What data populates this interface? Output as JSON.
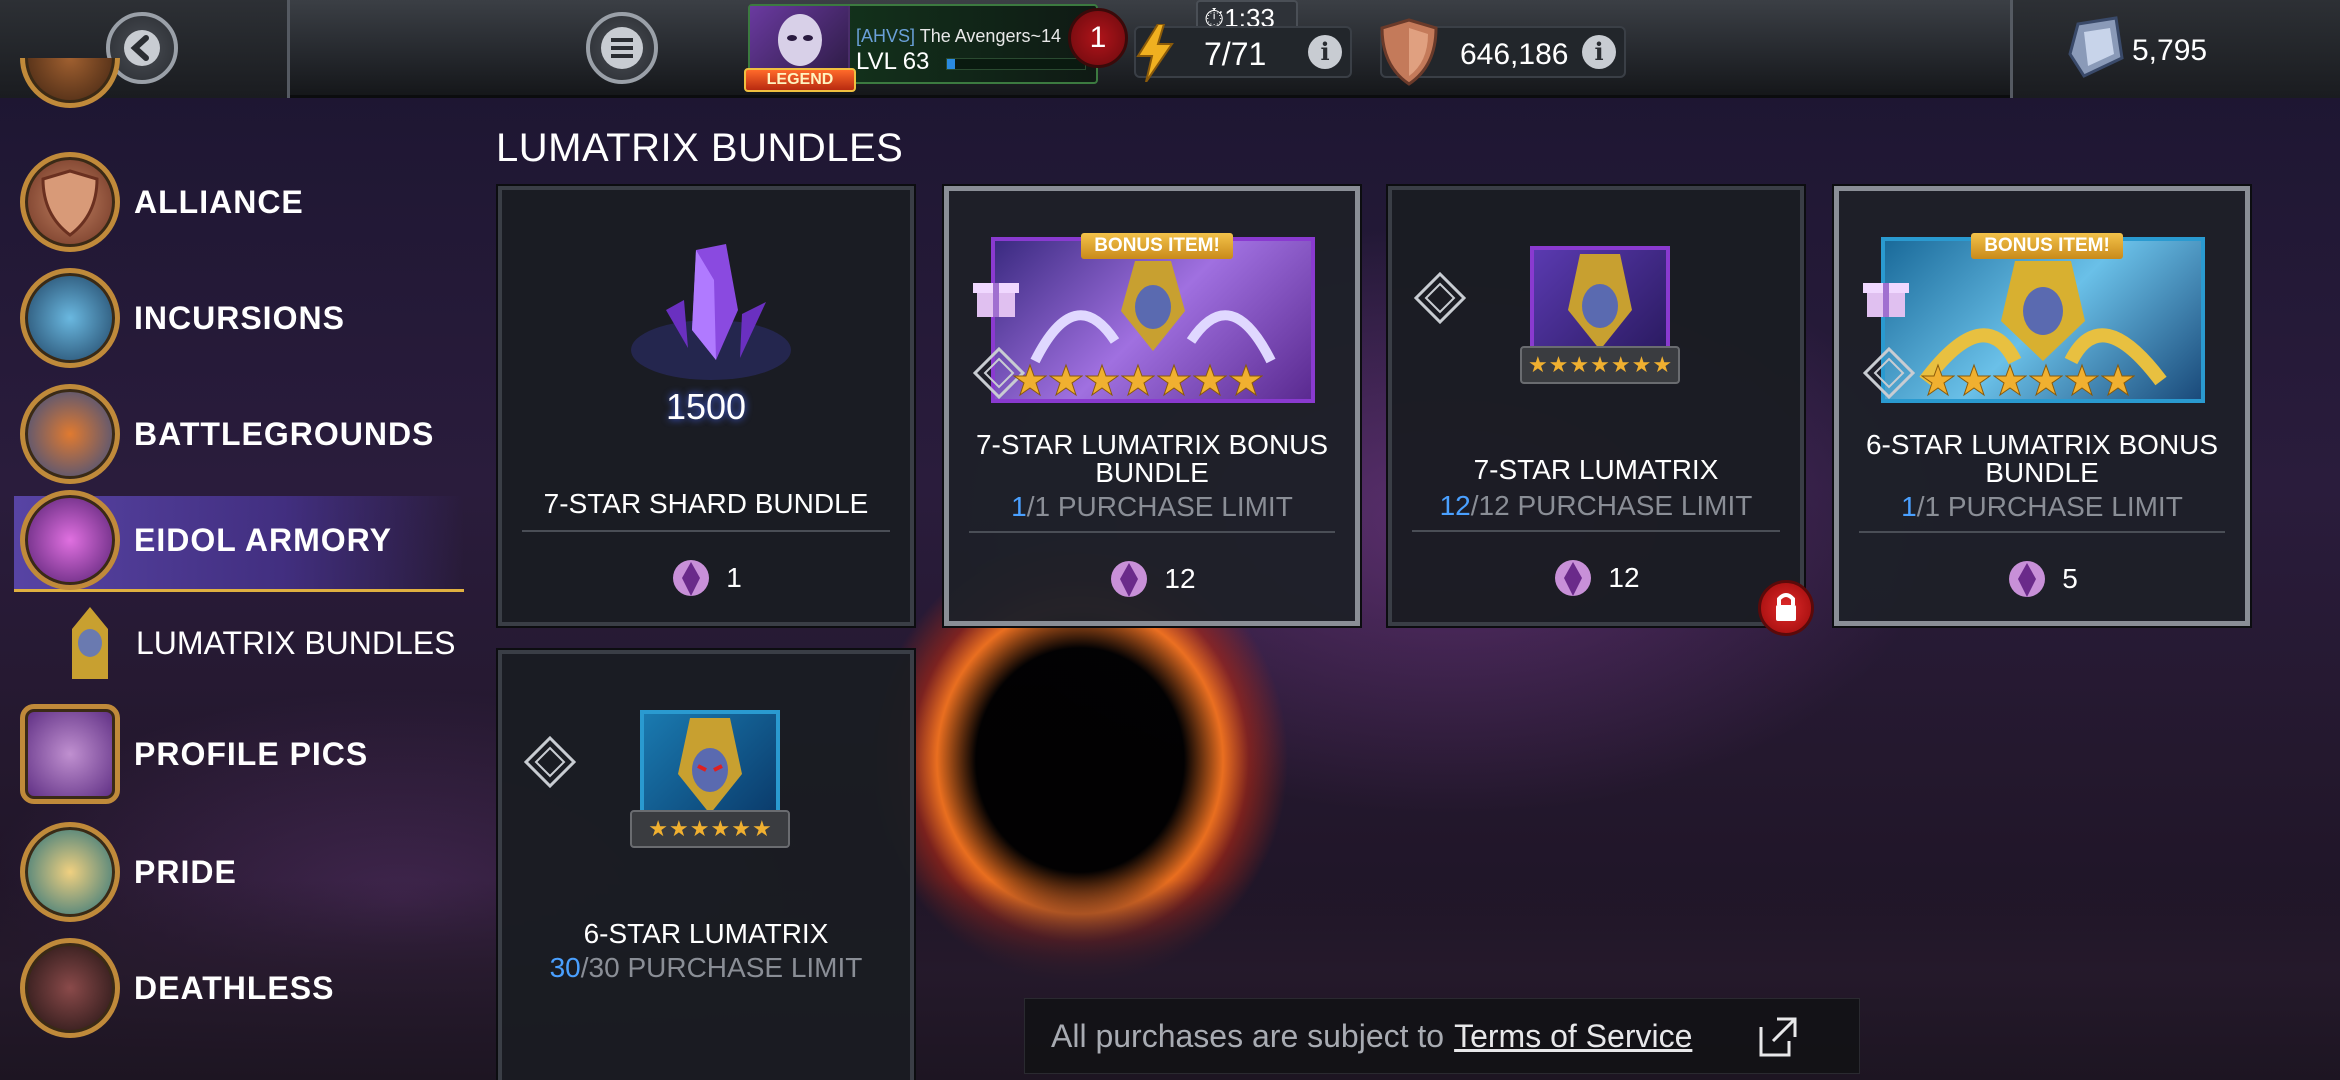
{
  "topbar": {
    "alliance_tag": "[AHVS]",
    "alliance_name": "The Avengers~14",
    "level": "LVL 63",
    "xp_progress": 0.06,
    "legend_label": "LEGEND",
    "notification_count": "1",
    "timer": "1:33",
    "energy": "7/71",
    "arena_points": "646,186",
    "units": "5,795"
  },
  "sidebar": {
    "items": [
      {
        "label": "ALLIANCE",
        "icon": "alliance-shield-icon"
      },
      {
        "label": "INCURSIONS",
        "icon": "incursions-icon"
      },
      {
        "label": "BATTLEGROUNDS",
        "icon": "battlegrounds-icon"
      },
      {
        "label": "EIDOL ARMORY",
        "icon": "eidol-armory-icon",
        "active": true
      },
      {
        "label": "PROFILE PICS",
        "icon": "profile-pics-icon"
      },
      {
        "label": "PRIDE",
        "icon": "pride-icon"
      },
      {
        "label": "DEATHLESS",
        "icon": "deathless-icon"
      }
    ],
    "sub_item": {
      "label": "LUMATRIX BUNDLES",
      "icon": "lumatrix-icon"
    }
  },
  "main": {
    "section_title": "LUMATRIX BUNDLES",
    "bonus_ribbon": "BONUS ITEM!",
    "shard_amount": "1500",
    "cards": [
      {
        "title": "7-STAR SHARD BUNDLE",
        "limit_current": "",
        "limit_text": "",
        "price": "1"
      },
      {
        "title": "7-STAR LUMATRIX BONUS BUNDLE",
        "limit_current": "1",
        "limit_text": "/1 PURCHASE LIMIT",
        "price": "12"
      },
      {
        "title": "7-STAR LUMATRIX",
        "limit_current": "12",
        "limit_text": "/12 PURCHASE LIMIT",
        "price": "12"
      },
      {
        "title": "6-STAR LUMATRIX BONUS BUNDLE",
        "limit_current": "1",
        "limit_text": "/1 PURCHASE LIMIT",
        "price": "5"
      },
      {
        "title": "6-STAR LUMATRIX",
        "limit_current": "30",
        "limit_text": "/30 PURCHASE LIMIT",
        "price": ""
      }
    ]
  },
  "footer": {
    "tos_prefix": "All purchases are subject to",
    "tos_link": "Terms of Service"
  },
  "colors": {
    "accent_blue": "#4aa0ff",
    "gold": "#f0b030",
    "active_nav": "#5a46aa"
  }
}
